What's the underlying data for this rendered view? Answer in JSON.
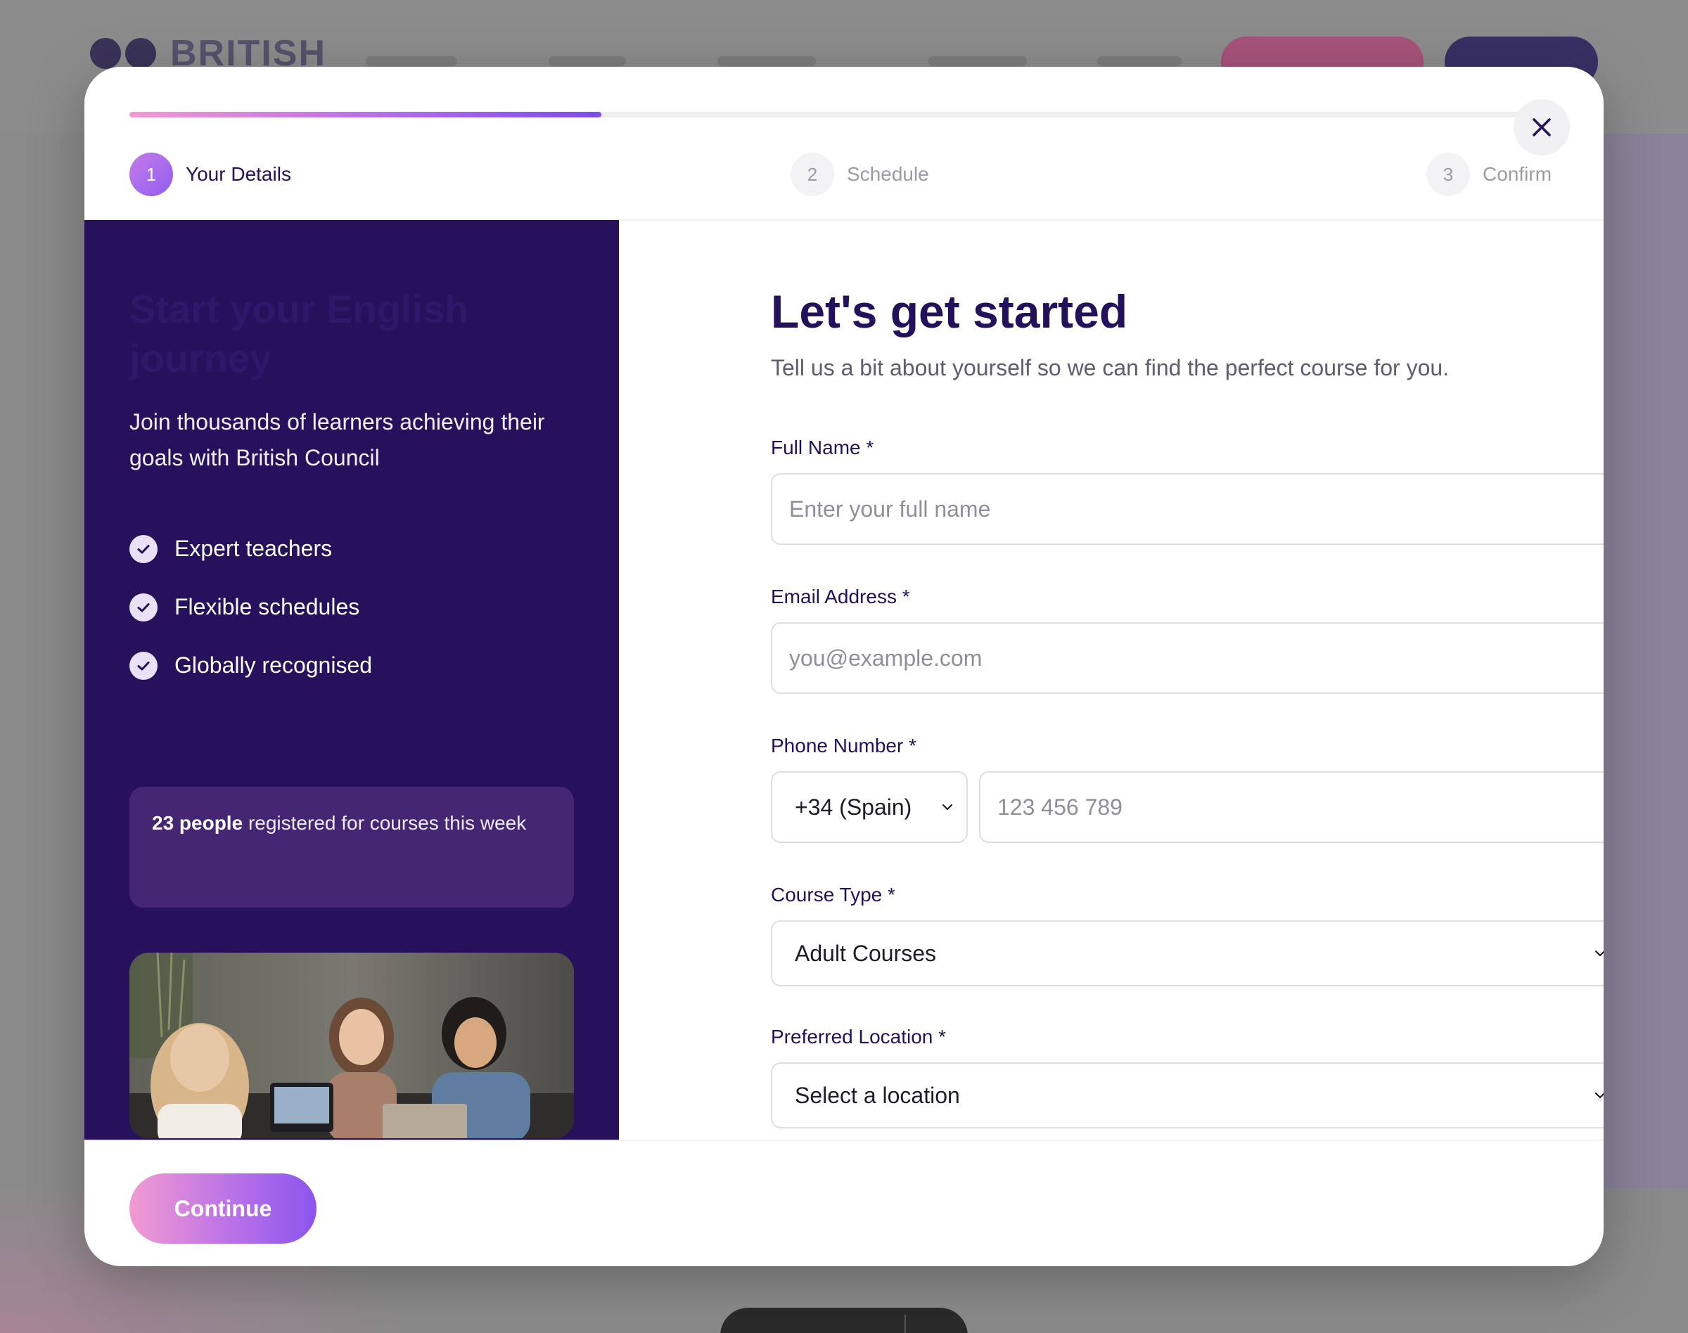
{
  "background": {
    "logo_text": "BRITISH"
  },
  "stepper": {
    "progress_percent": 33,
    "steps": [
      {
        "number": "1",
        "label": "Your Details",
        "active": true
      },
      {
        "number": "2",
        "label": "Schedule",
        "active": false
      },
      {
        "number": "3",
        "label": "Confirm",
        "active": false
      }
    ]
  },
  "left_panel": {
    "heading": "Start your English journey",
    "subtitle": "Join thousands of learners achieving their goals with British Council",
    "benefits": [
      "Expert teachers",
      "Flexible schedules",
      "Globally recognised"
    ],
    "social_proof": {
      "count_text": "23 people",
      "rest_text": " registered for courses this week"
    }
  },
  "form": {
    "title": "Let's get started",
    "subtitle": "Tell us a bit about yourself so we can find the perfect course for you.",
    "full_name": {
      "label": "Full Name *",
      "placeholder": "Enter your full name",
      "value": ""
    },
    "email": {
      "label": "Email Address *",
      "placeholder": "you@example.com",
      "value": ""
    },
    "phone": {
      "label": "Phone Number *",
      "country_code": "+34 (Spain)",
      "placeholder": "123 456 789",
      "value": ""
    },
    "course_type": {
      "label": "Course Type *",
      "selected": "Adult Courses"
    },
    "location": {
      "label": "Preferred Location *",
      "selected": "Select a location"
    }
  },
  "footer": {
    "continue_label": "Continue"
  },
  "colors": {
    "brand_dark": "#24115c",
    "panel_bg": "#27105c",
    "accent_pink": "#f29ad2",
    "accent_purple": "#8b55ee"
  }
}
